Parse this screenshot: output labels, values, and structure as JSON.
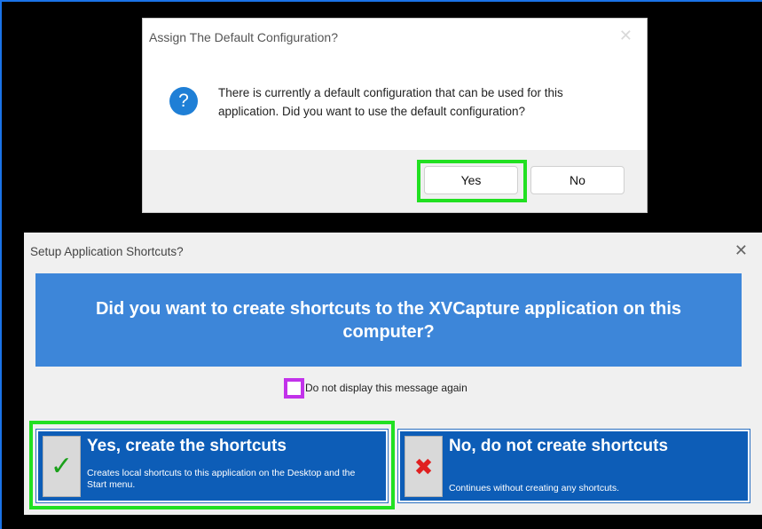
{
  "dialog1": {
    "title": "Assign The Default Configuration?",
    "close_glyph": "✕",
    "icon": "question-icon",
    "icon_glyph": "?",
    "message": "There is currently a default configuration that can be used for this application.  Did you want to use the default configuration?",
    "yes_label": "Yes",
    "no_label": "No",
    "highlight_color": "#21e021"
  },
  "dialog2": {
    "title": "Setup Application Shortcuts?",
    "close_glyph": "✕",
    "banner_text": "Did you want to create shortcuts to the XVCapture application on this computer?",
    "checkbox_label": "Do not display this message again",
    "checkbox_checked": false,
    "checkbox_highlight_color": "#c232ea",
    "create_button": {
      "icon": "checkmark-icon",
      "icon_glyph": "✓",
      "heading": "Yes, create the shortcuts",
      "description": "Creates local shortcuts to this application on the Desktop and the Start menu."
    },
    "nocreate_button": {
      "icon": "x-mark-icon",
      "icon_glyph": "✖",
      "heading": "No, do not create shortcuts",
      "description": "Continues without creating any shortcuts."
    },
    "banner_color": "#3d86d9",
    "button_color": "#0d5db7",
    "highlight_color": "#21e021"
  }
}
